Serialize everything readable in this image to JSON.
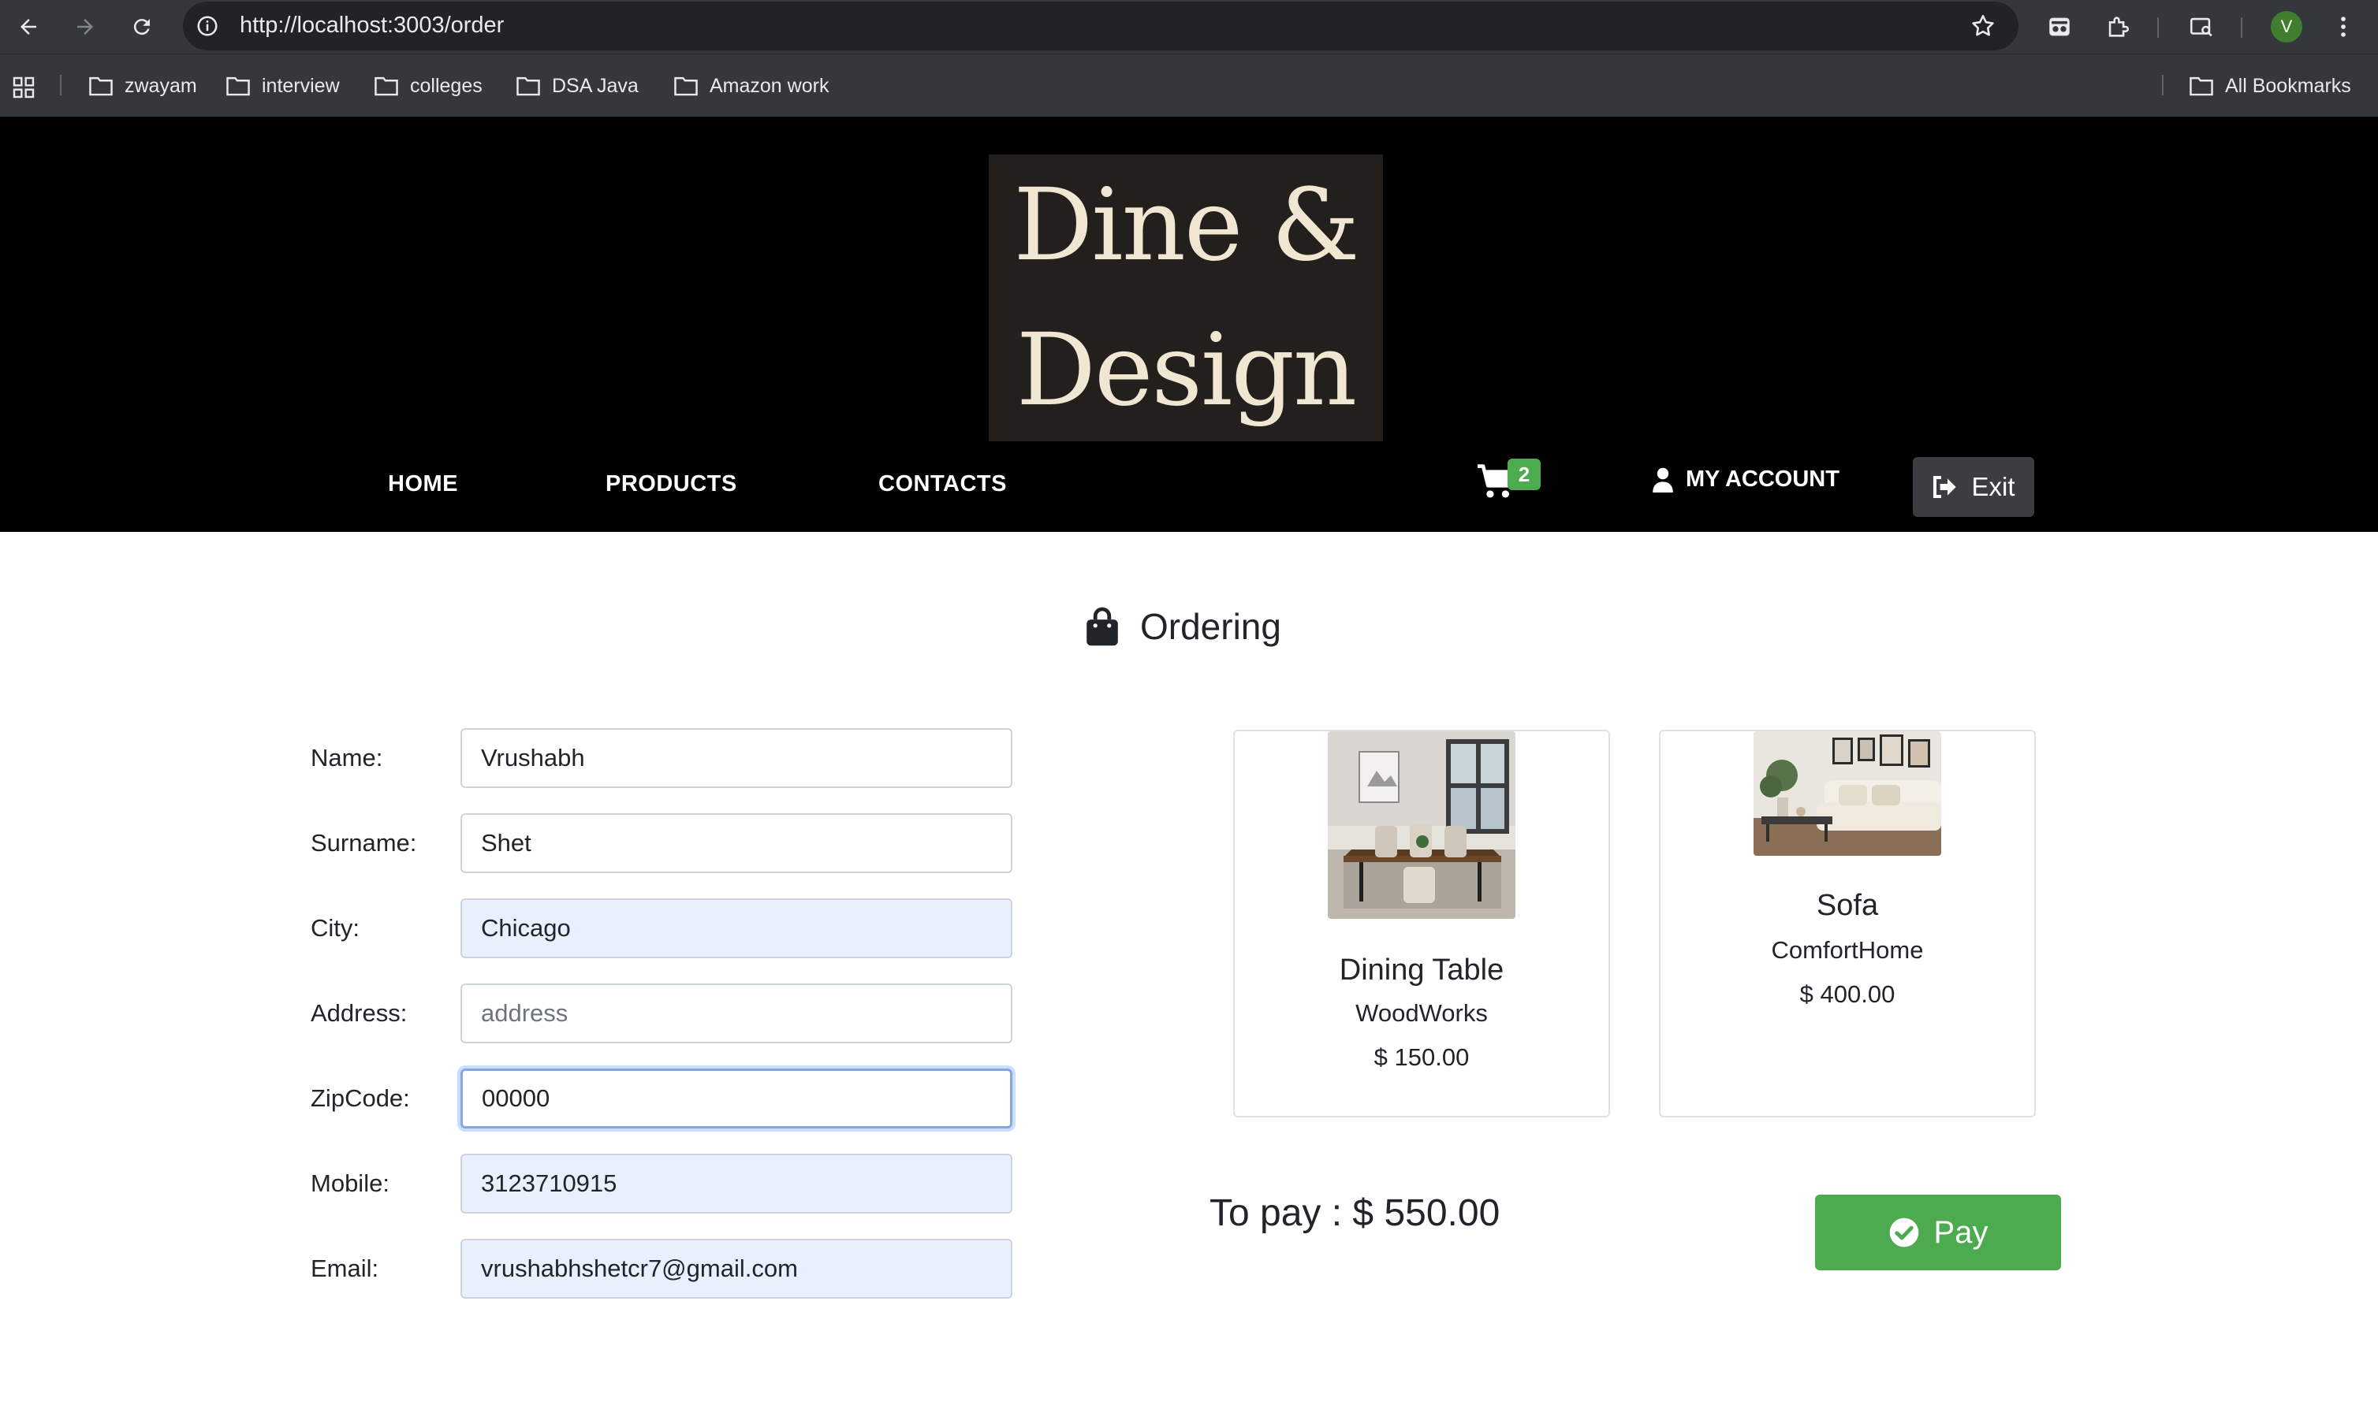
{
  "browser": {
    "url": "http://localhost:3003/order",
    "profile_initial": "V",
    "bookmarks": [
      "zwayam",
      "interview",
      "colleges",
      "DSA Java",
      "Amazon work"
    ],
    "all_bookmarks_label": "All Bookmarks"
  },
  "site": {
    "logo_line1": "Dine &",
    "logo_line2": "Design",
    "nav": {
      "home": "HOME",
      "products": "PRODUCTS",
      "contacts": "CONTACTS"
    },
    "cart_count": "2",
    "account_label": "MY ACCOUNT",
    "exit_label": "Exit",
    "colors": {
      "header_bg": "#000000",
      "accent_green": "#4caa4f",
      "logo_bg": "#231f1c"
    }
  },
  "order": {
    "heading": "Ordering",
    "form": {
      "name_label": "Name:",
      "name_value": "Vrushabh",
      "surname_label": "Surname:",
      "surname_value": "Shet",
      "city_label": "City:",
      "city_value": "Chicago",
      "address_label": "Address:",
      "address_placeholder": "address",
      "zip_label": "ZipCode:",
      "zip_value": "00000",
      "mobile_label": "Mobile:",
      "mobile_value": "3123710915",
      "email_label": "Email:",
      "email_value": "vrushabhshetcr7@gmail.com"
    },
    "items": [
      {
        "title": "Dining Table",
        "brand": "WoodWorks",
        "price": "$ 150.00"
      },
      {
        "title": "Sofa",
        "brand": "ComfortHome",
        "price": "$ 400.00"
      }
    ],
    "to_pay": "To pay : $ 550.00",
    "pay_label": "Pay"
  }
}
